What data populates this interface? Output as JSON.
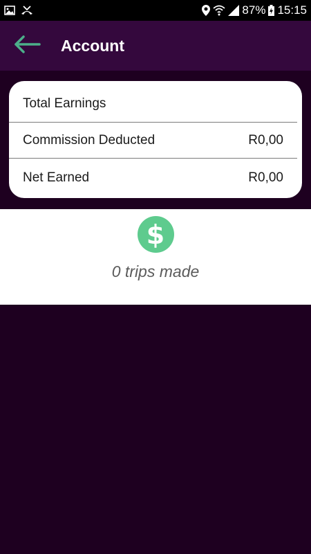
{
  "status_bar": {
    "icons_left": [
      "image-icon",
      "missed-call-icon"
    ],
    "icons_right": [
      "location-icon",
      "wifi-icon",
      "signal-icon"
    ],
    "battery": "87%",
    "time": "15:15"
  },
  "app_bar": {
    "back_icon": "arrow-left-icon",
    "title": "Account",
    "background_color": "#34083d",
    "accent_color": "#4caf8a"
  },
  "summary": {
    "rows": [
      {
        "label": "Total Earnings",
        "value": ""
      },
      {
        "label": "Commission Deducted",
        "value": "R0,00"
      },
      {
        "label": "Net Earned",
        "value": "R0,00"
      }
    ]
  },
  "trips": {
    "icon": "dollar-circle-icon",
    "text": "0 trips made",
    "icon_color": "#5ecb8e"
  },
  "page": {
    "background_color": "#1e0020"
  }
}
